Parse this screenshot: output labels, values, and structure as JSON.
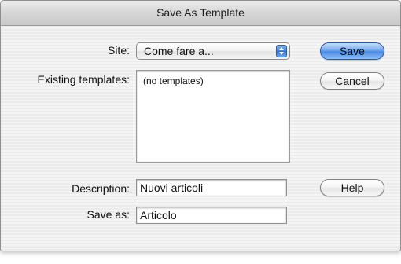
{
  "window": {
    "title": "Save As Template"
  },
  "form": {
    "site_label": "Site:",
    "site_value": "Come fare a...",
    "existing_label": "Existing templates:",
    "existing_items": [
      "(no templates)"
    ],
    "description_label": "Description:",
    "description_value": "Nuovi articoli",
    "save_as_label": "Save as:",
    "save_as_value": "Articolo"
  },
  "buttons": {
    "save": "Save",
    "cancel": "Cancel",
    "help": "Help"
  },
  "icons": {
    "popup": "updown-arrows-icon"
  },
  "colors": {
    "default_button": "#4a8ae6"
  }
}
